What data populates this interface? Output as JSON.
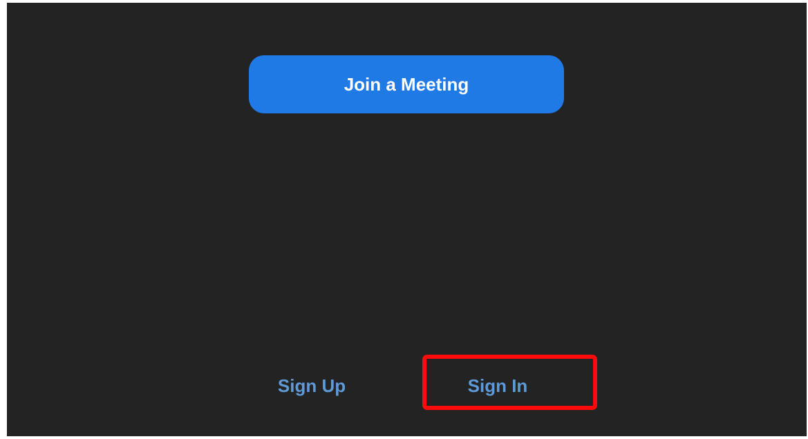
{
  "main": {
    "join_label": "Join a Meeting"
  },
  "footer": {
    "sign_up_label": "Sign Up",
    "sign_in_label": "Sign In"
  },
  "colors": {
    "background": "#232323",
    "primary_button": "#1f7ae6",
    "link": "#5f9ad8",
    "highlight": "#ff0a0a"
  }
}
